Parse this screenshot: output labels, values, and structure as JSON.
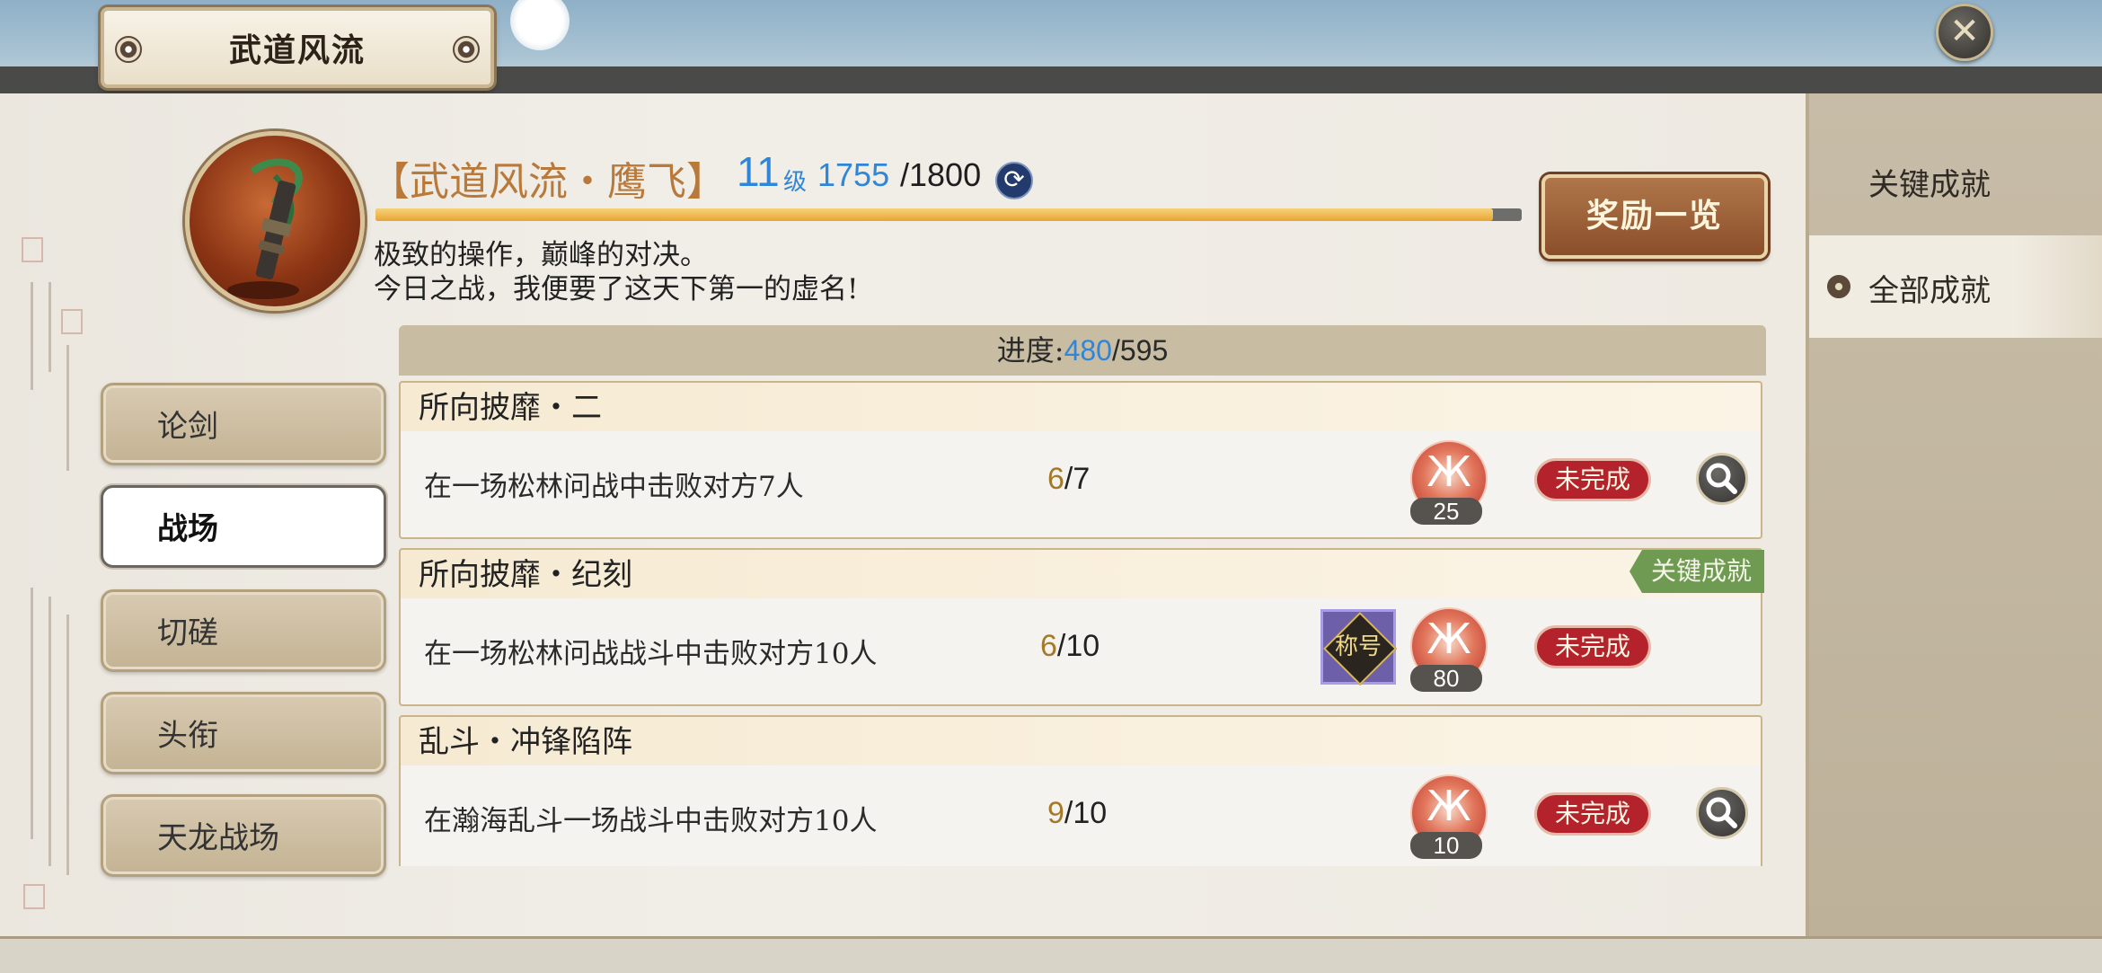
{
  "window": {
    "title": "武道风流",
    "close_icon": "close-icon"
  },
  "header": {
    "title": "【武道风流・鹰飞】",
    "level": "11",
    "level_unit": "级",
    "exp_current": "1755",
    "exp_max": "/1800",
    "exp_progress": 0.975,
    "description_line1": "极致的操作，巅峰的对决。",
    "description_line2": "今日之战，我便要了这天下第一的虚名!",
    "rewards_button": "奖励一览"
  },
  "progress": {
    "label": "进度:",
    "done": "480",
    "total": "/595"
  },
  "nav": {
    "items": [
      {
        "label": "论剑",
        "active": false
      },
      {
        "label": "战场",
        "active": true
      },
      {
        "label": "切磋",
        "active": false
      },
      {
        "label": "头衔",
        "active": false
      },
      {
        "label": "天龙战场",
        "active": false
      }
    ]
  },
  "achievements": [
    {
      "name": "所向披靡・二",
      "description": "在一场松林问战中击败对方7人",
      "progress_current": "6",
      "progress_total": "/7",
      "reward_count": "25",
      "status": "未完成",
      "key": false
    },
    {
      "name": "所向披靡・纪刻",
      "description": "在一场松林问战战斗中击败对方10人",
      "progress_current": "6",
      "progress_total": "/10",
      "reward_count": "80",
      "reward_item_label": "称号",
      "status": "未完成",
      "key": true,
      "key_label": "关键成就"
    },
    {
      "name": "乱斗・冲锋陷阵",
      "description": "在瀚海乱斗一场战斗中击败对方10人",
      "progress_current": "9",
      "progress_total": "/10",
      "reward_count": "10",
      "status": "未完成",
      "key": false
    }
  ],
  "sidebar": {
    "items": [
      {
        "label": "关键成就",
        "active": false
      },
      {
        "label": "全部成就",
        "active": true
      }
    ]
  },
  "colors": {
    "accent_blue": "#2f86d8",
    "title_gold": "#b8793a",
    "status_red": "#b4232c",
    "key_green": "#6f9a52"
  }
}
